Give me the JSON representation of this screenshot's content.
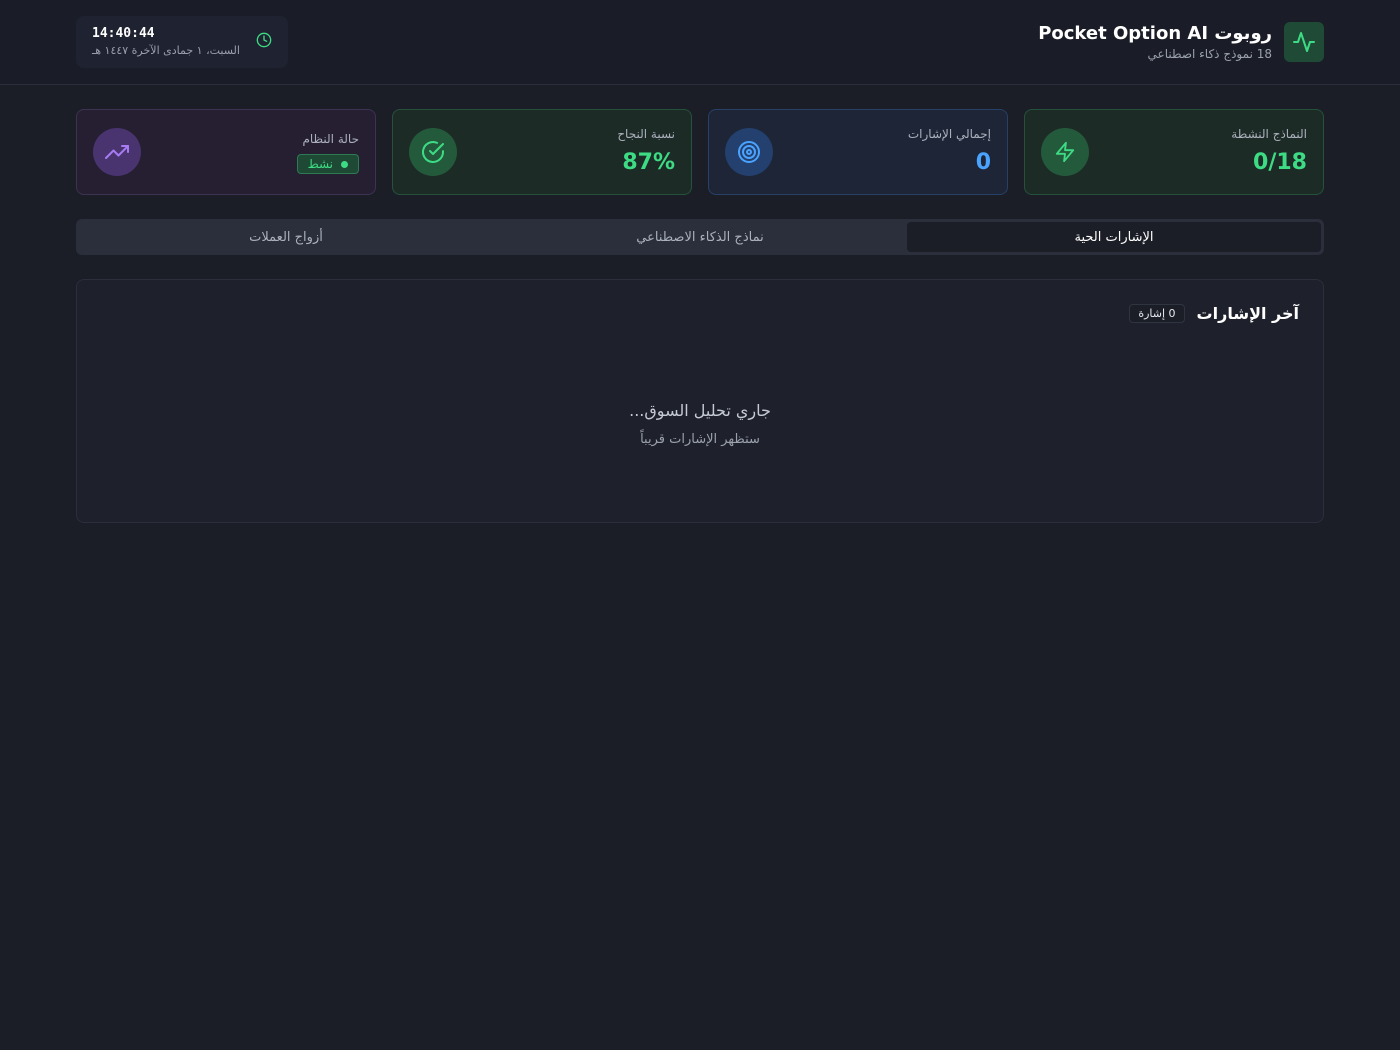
{
  "header": {
    "title": "روبوت Pocket Option AI",
    "subtitle": "18 نموذج ذكاء اصطناعي",
    "logo_icon": "activity-icon",
    "clock": {
      "time": "14:40:44",
      "date": "السبت، ١ جمادى الآخرة ١٤٤٧ هـ",
      "icon": "clock-icon"
    }
  },
  "stats": [
    {
      "label": "النماذج النشطة",
      "value": "0/18",
      "icon": "zap-icon",
      "color": "#3ddc84"
    },
    {
      "label": "إجمالي الإشارات",
      "value": "0",
      "icon": "target-icon",
      "color": "#4aa3ff"
    },
    {
      "label": "نسبة النجاح",
      "value": "87%",
      "icon": "check-circle-icon",
      "color": "#3ddc84"
    },
    {
      "label": "حالة النظام",
      "status": "نشط",
      "icon": "trending-up-icon",
      "color": "#a77bf3"
    }
  ],
  "tabs": [
    {
      "label": "الإشارات الحية",
      "active": true
    },
    {
      "label": "نماذج الذكاء الاصطناعي",
      "active": false
    },
    {
      "label": "أزواج العملات",
      "active": false
    }
  ],
  "signals_panel": {
    "title": "آخر الإشارات",
    "count_badge": "0 إشارة",
    "empty_title": "جاري تحليل السوق...",
    "empty_subtitle": "ستظهر الإشارات قريباً"
  }
}
